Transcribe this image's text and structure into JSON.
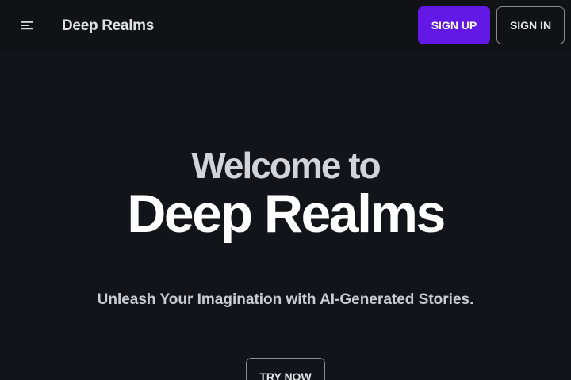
{
  "header": {
    "menu_icon": "menu-icon",
    "brand": "Deep Realms",
    "signup_label": "SIGN UP",
    "signin_label": "SIGN IN"
  },
  "hero": {
    "line1": "Welcome to",
    "line2": "Deep Realms",
    "tagline": "Unleash Your Imagination with AI-Generated Stories.",
    "cta_label": "TRY NOW"
  },
  "colors": {
    "background": "#131419",
    "header_background": "#111215",
    "accent": "#6319e6",
    "outline": "#8a8c94"
  }
}
